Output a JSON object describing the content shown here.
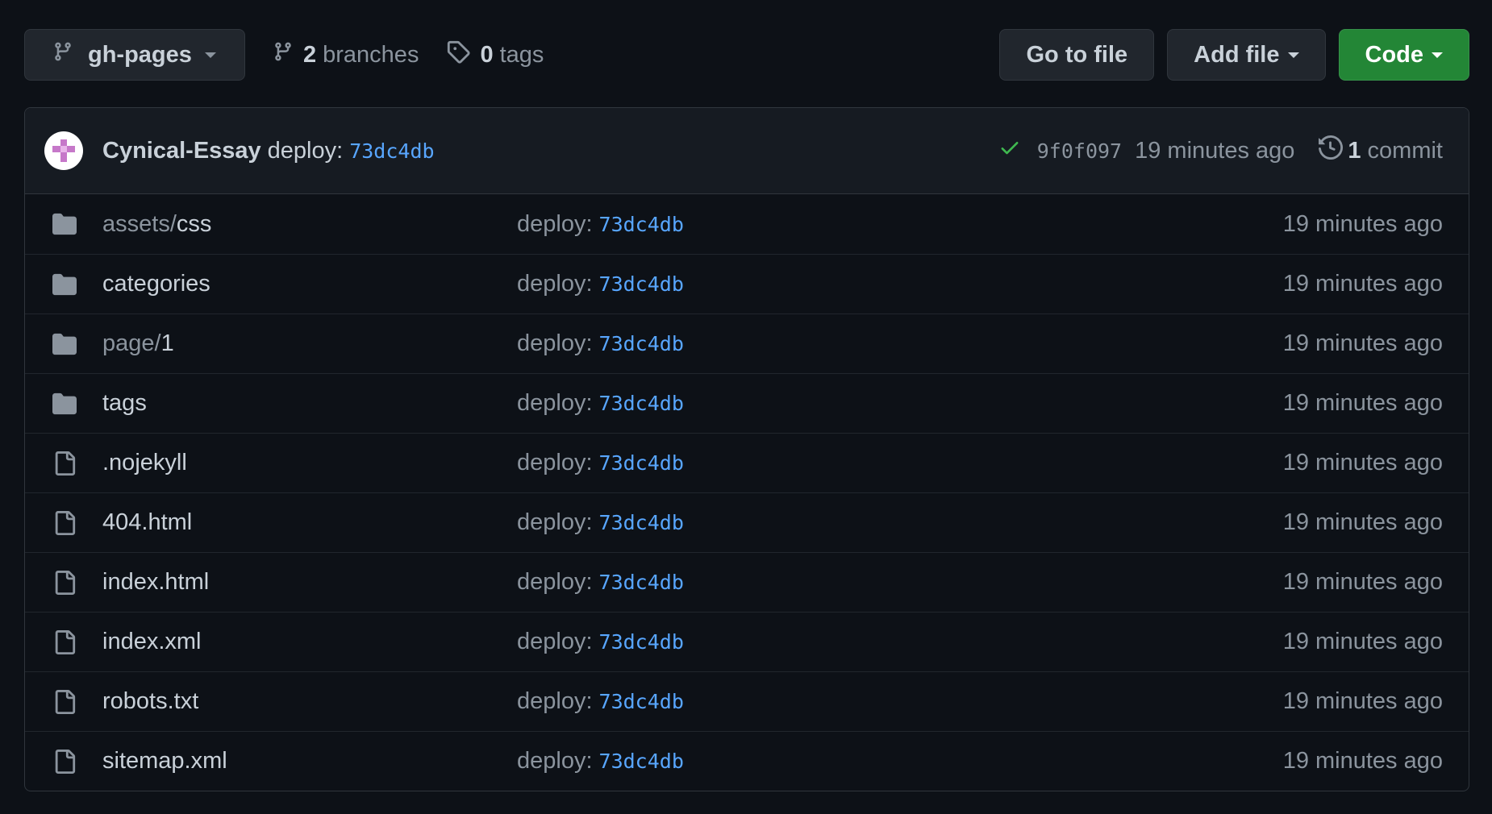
{
  "toolbar": {
    "branch": "gh-pages",
    "branches_count": "2",
    "branches_label": "branches",
    "tags_count": "0",
    "tags_label": "tags",
    "go_to_file": "Go to file",
    "add_file": "Add file",
    "code": "Code",
    "code_button_color": "#238636"
  },
  "commit": {
    "author": "Cynical-Essay",
    "message": "deploy:",
    "message_sha": "73dc4db",
    "sha": "9f0f097",
    "time": "19 minutes ago",
    "count": "1",
    "count_label": "commit",
    "status_color": "#3fb950"
  },
  "colors": {
    "background": "#0d1117",
    "link": "#58a6ff",
    "muted": "#8b949e"
  },
  "files": [
    {
      "icon": "folder-icon",
      "prefix": "assets/",
      "name": "css",
      "msg": "deploy:",
      "sha": "73dc4db",
      "time": "19 minutes ago"
    },
    {
      "icon": "folder-icon",
      "prefix": "",
      "name": "categories",
      "msg": "deploy:",
      "sha": "73dc4db",
      "time": "19 minutes ago"
    },
    {
      "icon": "folder-icon",
      "prefix": "page/",
      "name": "1",
      "msg": "deploy:",
      "sha": "73dc4db",
      "time": "19 minutes ago"
    },
    {
      "icon": "folder-icon",
      "prefix": "",
      "name": "tags",
      "msg": "deploy:",
      "sha": "73dc4db",
      "time": "19 minutes ago"
    },
    {
      "icon": "file-icon",
      "prefix": "",
      "name": ".nojekyll",
      "msg": "deploy:",
      "sha": "73dc4db",
      "time": "19 minutes ago"
    },
    {
      "icon": "file-icon",
      "prefix": "",
      "name": "404.html",
      "msg": "deploy:",
      "sha": "73dc4db",
      "time": "19 minutes ago"
    },
    {
      "icon": "file-icon",
      "prefix": "",
      "name": "index.html",
      "msg": "deploy:",
      "sha": "73dc4db",
      "time": "19 minutes ago"
    },
    {
      "icon": "file-icon",
      "prefix": "",
      "name": "index.xml",
      "msg": "deploy:",
      "sha": "73dc4db",
      "time": "19 minutes ago"
    },
    {
      "icon": "file-icon",
      "prefix": "",
      "name": "robots.txt",
      "msg": "deploy:",
      "sha": "73dc4db",
      "time": "19 minutes ago"
    },
    {
      "icon": "file-icon",
      "prefix": "",
      "name": "sitemap.xml",
      "msg": "deploy:",
      "sha": "73dc4db",
      "time": "19 minutes ago"
    }
  ]
}
